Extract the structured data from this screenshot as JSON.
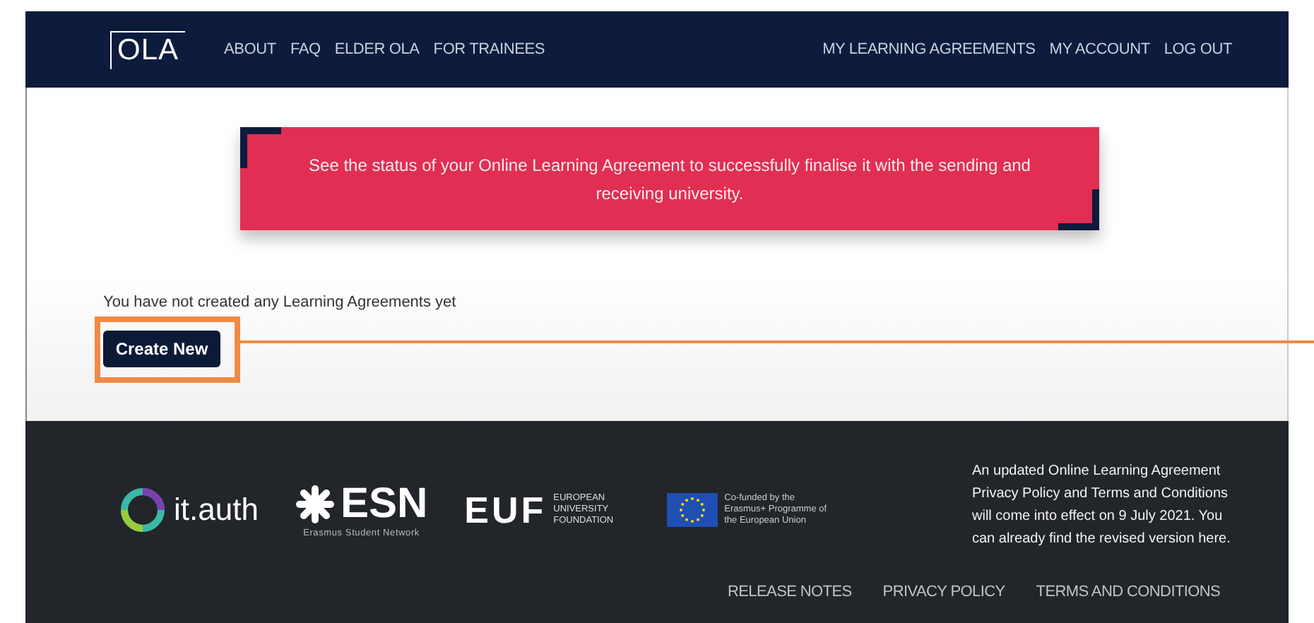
{
  "header": {
    "logo": "OLA",
    "nav_left": [
      "ABOUT",
      "FAQ",
      "ELDER OLA",
      "FOR TRAINEES"
    ],
    "nav_right": [
      "MY LEARNING AGREEMENTS",
      "MY ACCOUNT",
      "LOG OUT"
    ]
  },
  "banner": {
    "text": "See the status of your Online Learning Agreement to successfully finalise it with the sending and receiving university."
  },
  "main": {
    "message": "You have not created any Learning Agreements yet",
    "button": "Create New",
    "annotation": {
      "kind": "highlight"
    }
  },
  "footer": {
    "logos": [
      {
        "kind": "itauth",
        "name": "it.auth"
      },
      {
        "kind": "esn",
        "name": "ESN",
        "subtitle": "Erasmus Student Network"
      },
      {
        "kind": "euf",
        "name": "EUF",
        "subtitle": "EUROPEAN UNIVERSITY FOUNDATION"
      },
      {
        "kind": "eu",
        "subtitle": "Co-funded by the Erasmus+ Programme of the European Union"
      }
    ],
    "notice": "An updated Online Learning Agreement Privacy Policy and Terms and Conditions will come into effect on 9 July 2021. You can already find the revised version here.",
    "links": [
      "RELEASE NOTES",
      "PRIVACY POLICY",
      "TERMS AND CONDITIONS"
    ]
  }
}
